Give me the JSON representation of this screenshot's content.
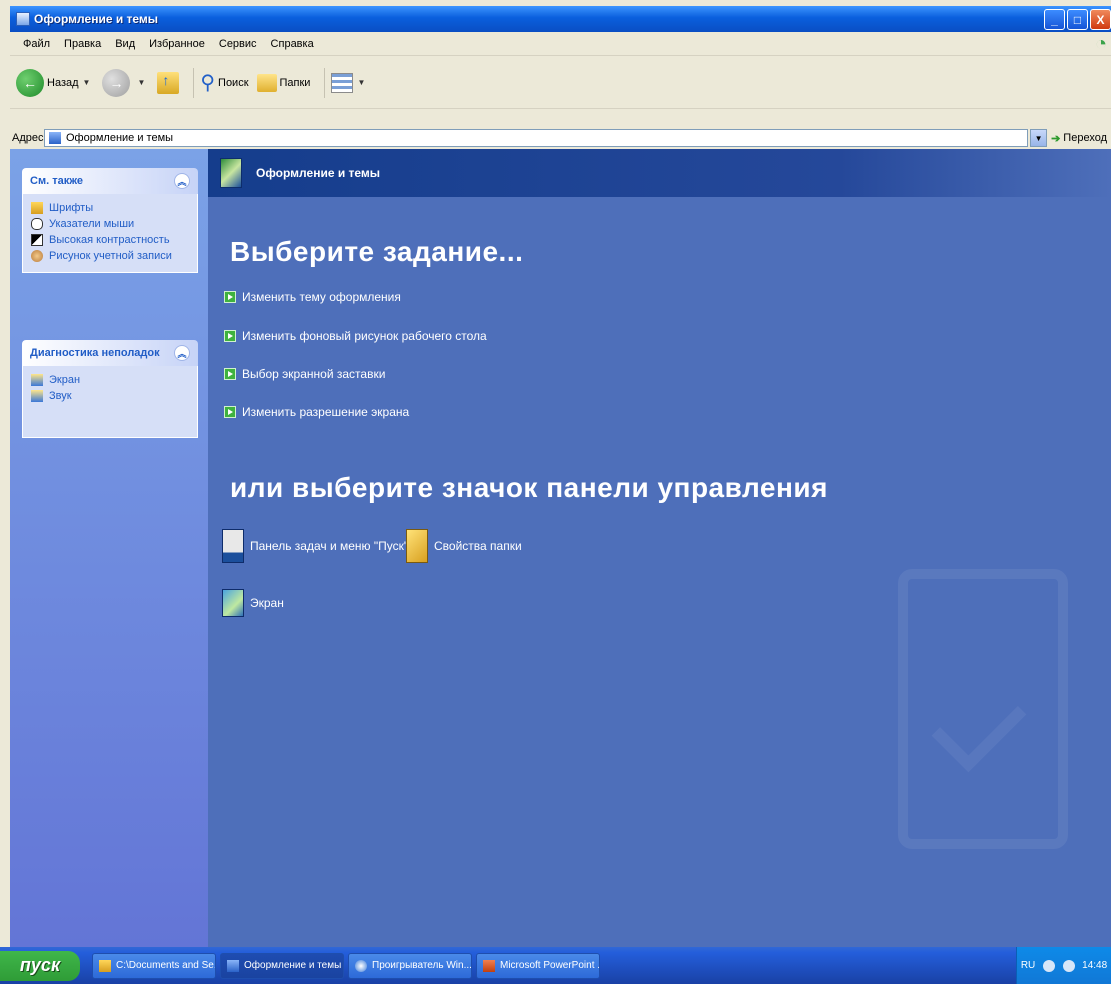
{
  "window": {
    "title": "Оформление и темы",
    "controls": {
      "minimize": "_",
      "maximize": "□",
      "close": "X"
    }
  },
  "menubar": {
    "items": [
      "Файл",
      "Правка",
      "Вид",
      "Избранное",
      "Сервис",
      "Справка"
    ]
  },
  "toolbar": {
    "back_label": "Назад",
    "search_label": "Поиск",
    "folders_label": "Папки"
  },
  "address": {
    "label": "Адрес:",
    "value": "Оформление и темы",
    "go_label": "Переход"
  },
  "sidebar": {
    "see_also": {
      "title": "См. также",
      "items": [
        "Шрифты",
        "Указатели мыши",
        "Высокая контрастность",
        "Рисунок учетной записи"
      ]
    },
    "troubleshoot": {
      "title": "Диагностика неполадок",
      "items": [
        "Экран",
        "Звук"
      ]
    }
  },
  "main": {
    "header_title": "Оформление и темы",
    "task_heading": "Выберите задание...",
    "tasks": [
      "Изменить тему оформления",
      "Изменить фоновый рисунок рабочего стола",
      "Выбор экранной заставки",
      "Изменить разрешение экрана"
    ],
    "cp_heading": "или выберите значок панели управления",
    "cp_icons": [
      "Панель задач и меню \"Пуск\"",
      "Свойства папки",
      "Экран"
    ]
  },
  "taskbar": {
    "start_label": "пуск",
    "buttons": [
      "C:\\Documents and Se...",
      "Оформление и темы",
      "Проигрыватель Win...",
      "Microsoft PowerPoint ..."
    ],
    "tray": {
      "lang": "RU",
      "time": "14:48"
    }
  },
  "colors": {
    "main_bg": "#4e6fba",
    "header_bg": "#153d8c",
    "sidebar_bg": "#7ba2e7",
    "titlebar": "#0a5fdd",
    "task_icon_green": "#3fb23f"
  }
}
